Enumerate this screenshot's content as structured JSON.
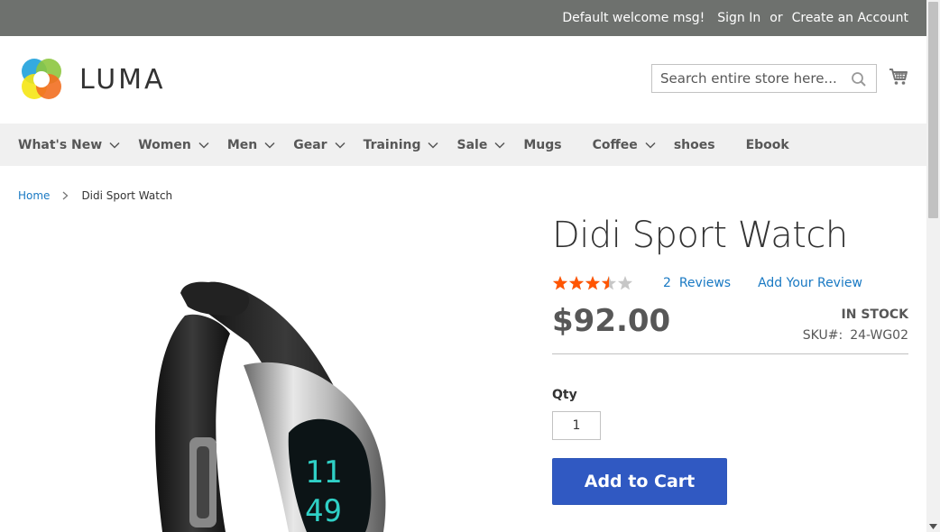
{
  "topbar": {
    "welcome": "Default welcome msg!",
    "sign_in": "Sign In",
    "or": "or",
    "create_account": "Create an Account"
  },
  "header": {
    "logo_text": "LUMA",
    "search_placeholder": "Search entire store here...",
    "search_icon": "magnifier-icon",
    "cart_icon": "shopping-cart-icon"
  },
  "nav": {
    "items": [
      {
        "label": "What's New",
        "has_dropdown": true
      },
      {
        "label": "Women",
        "has_dropdown": true
      },
      {
        "label": "Men",
        "has_dropdown": true
      },
      {
        "label": "Gear",
        "has_dropdown": true
      },
      {
        "label": "Training",
        "has_dropdown": true
      },
      {
        "label": "Sale",
        "has_dropdown": true
      },
      {
        "label": "Mugs",
        "has_dropdown": false
      },
      {
        "label": "Coffee",
        "has_dropdown": true
      },
      {
        "label": "shoes",
        "has_dropdown": false
      },
      {
        "label": "Ebook",
        "has_dropdown": false
      }
    ]
  },
  "breadcrumb": {
    "home": "Home",
    "current": "Didi Sport Watch"
  },
  "product": {
    "title": "Didi Sport Watch",
    "rating_fraction": 0.7,
    "reviews_count": "2",
    "reviews_label": "Reviews",
    "add_review": "Add Your Review",
    "price": "$92.00",
    "stock": "In stock",
    "sku_label": "SKU#:",
    "sku_value": "24-WG02",
    "qty_label": "Qty",
    "qty_value": "1",
    "add_to_cart": "Add to Cart",
    "watch_display": "11 49"
  },
  "colors": {
    "topbar_bg": "#6e716e",
    "nav_bg": "#f0f0f0",
    "link": "#1979c3",
    "star_on": "#ff5501",
    "star_off": "#c7c7c7",
    "button_bg": "#3059c2"
  }
}
